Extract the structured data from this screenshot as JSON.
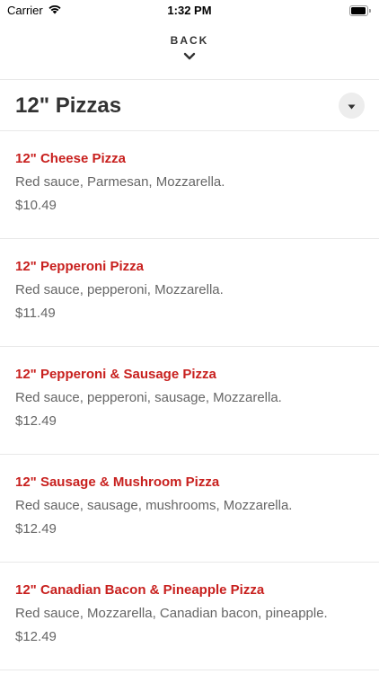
{
  "status_bar": {
    "carrier": "Carrier",
    "time": "1:32 PM",
    "wifi_icon": "wifi-icon",
    "battery_icon": "battery-icon"
  },
  "nav": {
    "back_label": "BACK",
    "back_icon": "chevron-down-icon"
  },
  "category": {
    "title": "12\" Pizzas",
    "dropdown_icon": "caret-down-icon"
  },
  "colors": {
    "accent": "#c8201e",
    "text_primary": "#333333",
    "text_secondary": "#666666"
  },
  "items": [
    {
      "name": "12\" Cheese Pizza",
      "description": "Red sauce, Parmesan, Mozzarella.",
      "price": "$10.49"
    },
    {
      "name": "12\" Pepperoni Pizza",
      "description": "Red sauce, pepperoni, Mozzarella.",
      "price": "$11.49"
    },
    {
      "name": "12\" Pepperoni & Sausage Pizza",
      "description": "Red sauce, pepperoni, sausage, Mozzarella.",
      "price": "$12.49"
    },
    {
      "name": "12\" Sausage & Mushroom Pizza",
      "description": "Red sauce, sausage, mushrooms, Mozzarella.",
      "price": "$12.49"
    },
    {
      "name": "12\" Canadian Bacon & Pineapple Pizza",
      "description": "Red sauce, Mozzarella, Canadian bacon, pineapple.",
      "price": "$12.49"
    }
  ]
}
